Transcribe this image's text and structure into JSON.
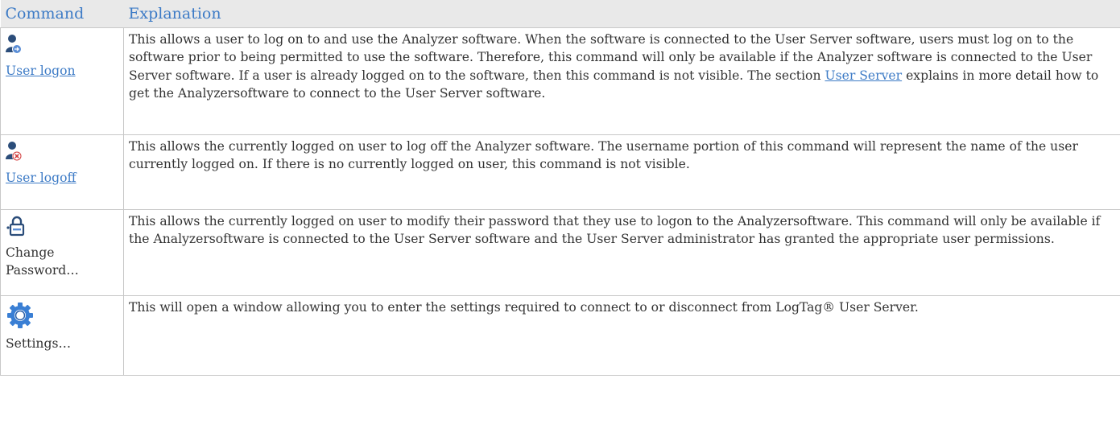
{
  "header": {
    "command": "Command",
    "explanation": "Explanation"
  },
  "rows": [
    {
      "icon": "user-logon-icon",
      "command": "User logon",
      "command_is_link": true,
      "explanation_before": "This allows a user to log on to and use the Analyzer software. When the software is connected to the User Server software, users must log on to the software prior to being permitted to use the software. Therefore, this command will only be available if the Analyzer software is connected to the User Server software. If a user is already logged on to the software, then this command is not visible. The section ",
      "explanation_link": "User Server",
      "explanation_after": " explains in more detail how to get the Analyzersoftware to connect to the User Server software."
    },
    {
      "icon": "user-logoff-icon",
      "command": "User logoff",
      "command_is_link": true,
      "explanation": "This allows the currently logged on user to log off the Analyzer software. The username portion of this command will represent the name of the user currently logged on. If there is no currently logged on user, this command is not visible."
    },
    {
      "icon": "change-password-icon",
      "command": "Change Password…",
      "command_is_link": false,
      "explanation": "This allows the currently logged on user to modify their password that they use to logon to the Analyzersoftware. This command will only be available if the Analyzersoftware is connected to the User Server software and the User Server administrator has granted the appropriate user permissions."
    },
    {
      "icon": "settings-gear-icon",
      "command": "Settings…",
      "command_is_link": false,
      "explanation": "This will open a window allowing you to enter the settings required to connect to or disconnect from LogTag® User Server."
    }
  ],
  "colors": {
    "header_text": "#3d7bc6",
    "header_bg": "#e9e9e9",
    "link": "#3d7bc6",
    "user_icon": "#2b4d7a",
    "logon_badge": "#5b8ed6",
    "logoff_badge": "#d23b3b",
    "gear": "#3a7fd4"
  }
}
